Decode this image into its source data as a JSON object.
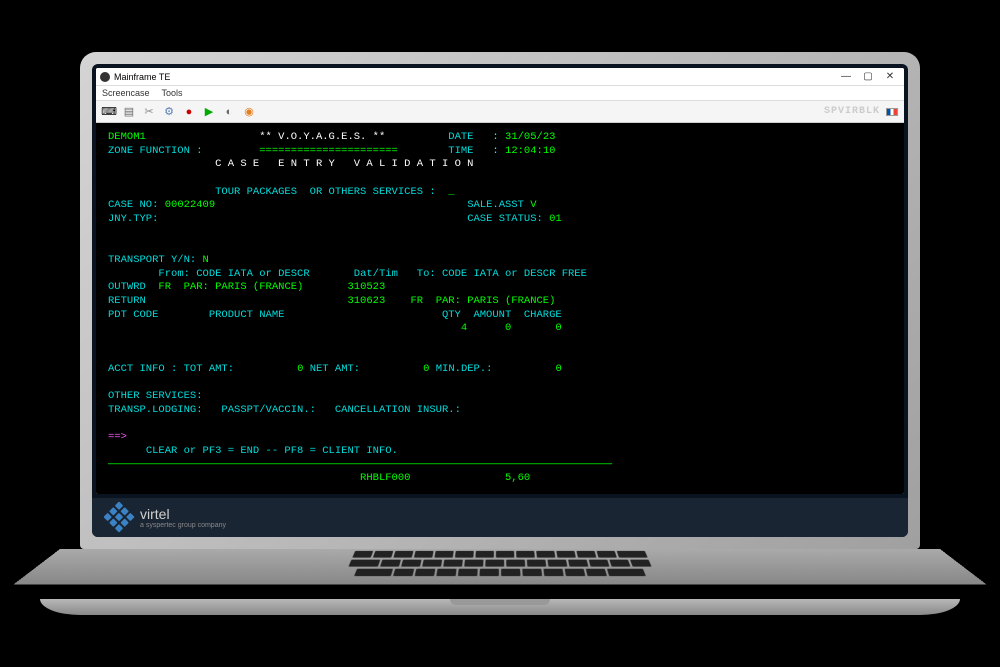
{
  "window": {
    "title": "Mainframe TE",
    "menu": [
      "Screencase",
      "Tools"
    ],
    "spvirblk": "SPVIRBLK"
  },
  "header": {
    "demo": "DEMOM1",
    "title": "** V.O.Y.A.G.E.S. **",
    "date_label": "DATE",
    "date": "31/05/23",
    "zone_label": "ZONE FUNCTION :",
    "zone_sep": "======================",
    "time_label": "TIME",
    "time": "12:04:10",
    "subtitle": "C A S E   E N T R Y   V A L I D A T I O N",
    "tour_label": "TOUR PACKAGES  OR OTHERS SERVICES :",
    "tour_value": "_"
  },
  "case": {
    "case_no_label": "CASE NO:",
    "case_no": "00022409",
    "sale_asst_label": "SALE.ASST",
    "sale_asst": "V",
    "jny_typ_label": "JNY.TYP:",
    "case_status_label": "CASE STATUS:",
    "case_status": "01"
  },
  "transport": {
    "label": "TRANSPORT Y/N:",
    "value": "N",
    "from_label": "From: CODE IATA or DESCR",
    "dat_tim": "Dat/Tim",
    "to_label": "To: CODE IATA or DESCR FREE",
    "outward_label": "OUTWRD",
    "outward_from": "FR  PAR: PARIS (FRANCE)",
    "outward_date": "310523",
    "return_label": "RETURN",
    "return_date": "310623",
    "return_to": "FR  PAR: PARIS (FRANCE)",
    "cols": "PDT CODE        PRODUCT NAME                         QTY  AMOUNT  CHARGE",
    "qty": "4",
    "amount": "0",
    "charge": "0"
  },
  "acct": {
    "label": "ACCT INFO :",
    "tot_label": "TOT AMT:",
    "tot": "0",
    "net_label": "NET AMT:",
    "net": "0",
    "min_label": "MIN.DEP.:",
    "min": "0"
  },
  "other": {
    "label": "OTHER SERVICES:",
    "transp": "TRANSP.LODGING:",
    "passpt": "PASSPT/VACCIN.:",
    "cancel": "CANCELLATION INSUR.:"
  },
  "cmd": {
    "prompt": "==>",
    "hint": "CLEAR or PF3 = END -- PF8 = CLIENT INFO."
  },
  "status": {
    "code": "RHBLF000",
    "pos": "5,60"
  },
  "brand": {
    "name": "virtel",
    "tagline": "a syspertec group company"
  }
}
